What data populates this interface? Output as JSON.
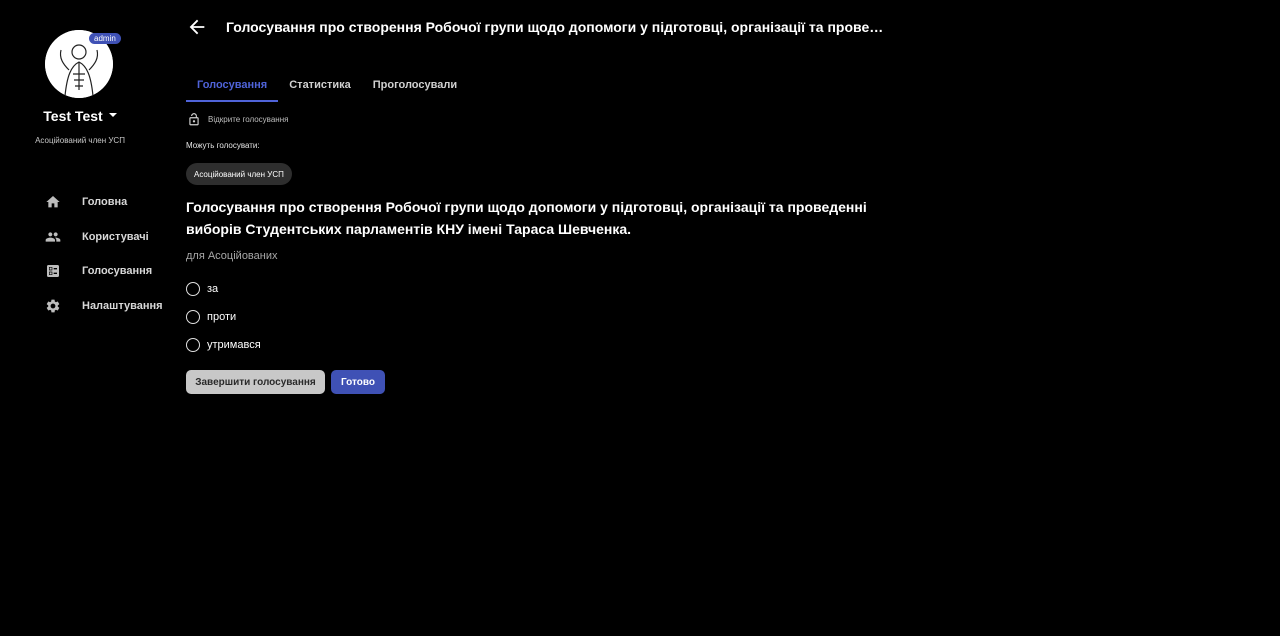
{
  "user": {
    "badge": "admin",
    "name": "Test Test",
    "role": "Асоційований член УСП"
  },
  "sidebar": {
    "items": [
      {
        "label": "Головна",
        "icon": "home-icon"
      },
      {
        "label": "Користувачі",
        "icon": "users-icon"
      },
      {
        "label": "Голосування",
        "icon": "ballot-icon"
      },
      {
        "label": "Налаштування",
        "icon": "gear-icon"
      }
    ]
  },
  "header": {
    "title": "Голосування про створення Робочої групи щодо допомоги у підготовці, організації та проведе…"
  },
  "tabs": [
    {
      "label": "Голосування",
      "active": true
    },
    {
      "label": "Статистика",
      "active": false
    },
    {
      "label": "Проголосували",
      "active": false
    }
  ],
  "vote": {
    "type_label": "Відкрите голосування",
    "can_vote_label": "Можуть голосувати:",
    "eligible_group": "Асоційований член УСП",
    "question": "Голосування про створення Робочої групи щодо допомоги у підготовці, організації та проведенні виборів Студентських парламентів КНУ імені Тараса Шевченка.",
    "audience": "для Асоційованих",
    "options": [
      {
        "label": "за"
      },
      {
        "label": "проти"
      },
      {
        "label": "утримався"
      }
    ],
    "finish_label": "Завершити голосування",
    "done_label": "Готово"
  },
  "colors": {
    "background": "#000000",
    "accent": "#3f51b5",
    "active_tab": "#4f63d9",
    "finish_button": "#c8c8c8"
  }
}
